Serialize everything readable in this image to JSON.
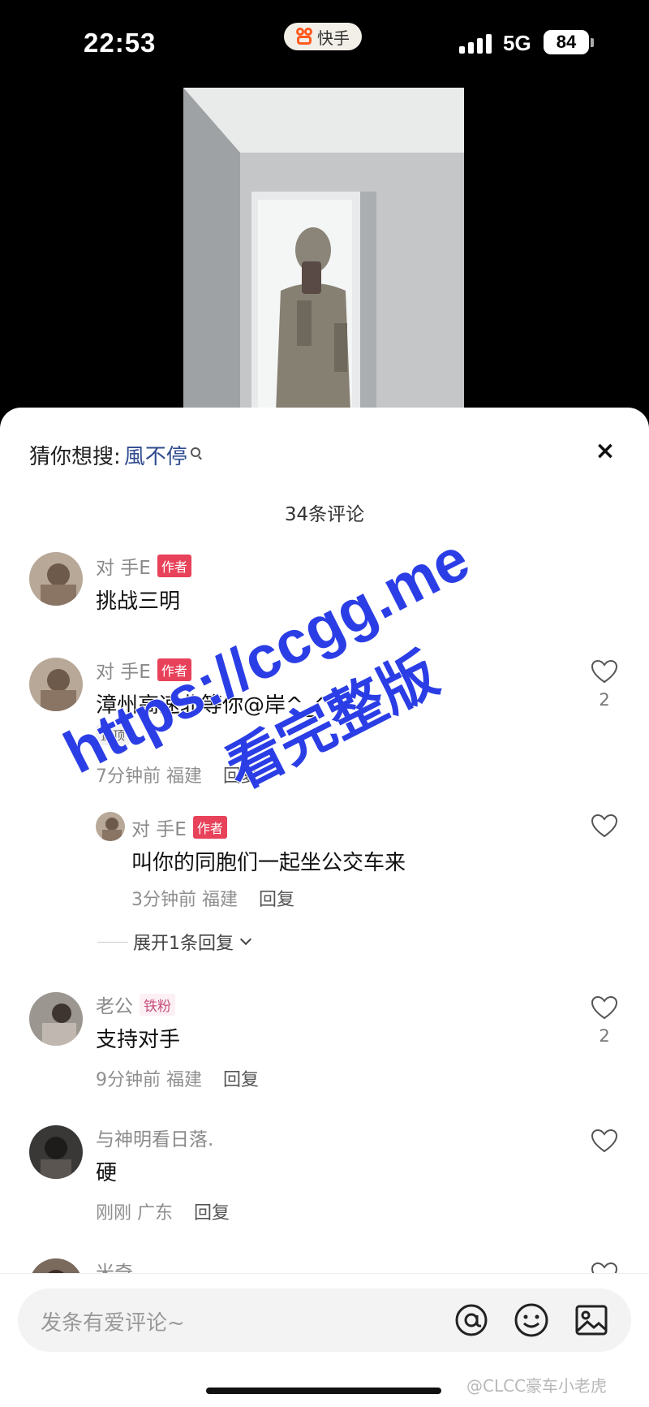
{
  "status": {
    "time": "22:53",
    "app": "快手",
    "network": "5G",
    "battery": "84"
  },
  "sheet": {
    "suggest_label": "猜你想搜:",
    "suggest_keyword": "風不停",
    "close": "×",
    "comment_count": "34条评论"
  },
  "comments": [
    {
      "name": "对 手E",
      "tag": "作者",
      "text": "挑战三明"
    },
    {
      "name": "对 手E",
      "tag": "作者",
      "text": "漳州高速北等你@岸^_^",
      "pin": "置顶",
      "time": "7分钟前",
      "location": "福建",
      "reply": "回复",
      "likes": "2",
      "replies": [
        {
          "name": "对 手E",
          "tag": "作者",
          "text": "叫你的同胞们一起坐公交车来",
          "time": "3分钟前",
          "location": "福建",
          "reply": "回复"
        }
      ],
      "expand": "展开1条回复"
    },
    {
      "name": "老公",
      "tag": "铁粉",
      "text": "支持对手",
      "time": "9分钟前",
      "location": "福建",
      "reply": "回复",
      "likes": "2"
    },
    {
      "name": "与神明看日落.",
      "text": "硬",
      "time": "刚刚",
      "location": "广东",
      "reply": "回复"
    },
    {
      "name": "米奇"
    }
  ],
  "input": {
    "placeholder": "发条有爱评论~"
  },
  "watermark": {
    "line1": "https://ccgg.me",
    "line2": "看完整版"
  },
  "credit": "@CLCC豪车小老虎",
  "colors": {
    "author_tag": "#e8425a",
    "watermark": "#2b3ee6",
    "keyword": "#2f4b8f"
  }
}
